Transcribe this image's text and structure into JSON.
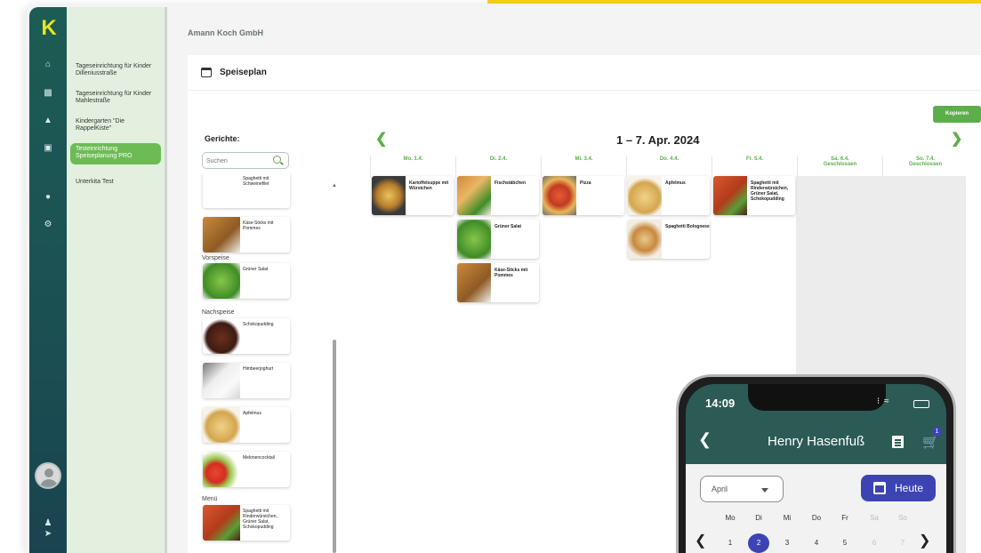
{
  "app": {
    "logo_letter": "K",
    "company": "Amann Koch GmbH",
    "colors": {
      "brand_dark": "#1d5c55",
      "accent_green": "#5cae4a",
      "logo_yellow": "#e6e61d",
      "phone_primary": "#3c44b3"
    }
  },
  "rail": {
    "icons": [
      "home-icon",
      "layers-icon",
      "upload-icon",
      "calendar-icon",
      "users-icon",
      "gear-icon",
      "person-icon",
      "logout-icon"
    ]
  },
  "sidebar": {
    "items": [
      {
        "label": "Tageseinrichtung für Kinder Dilleniusstraße"
      },
      {
        "label": "Tageseinrichtung für Kinder Mahlestraße"
      },
      {
        "label": "Kindergarten \"Die RappelKiste\""
      },
      {
        "label": "Testeinrichtung Speiseplanung PRO",
        "active": true
      },
      {
        "label": "Unterkita Test"
      }
    ]
  },
  "page": {
    "title": "Speiseplan",
    "copy_button": "Kopieren",
    "dishes_label": "Gerichte:",
    "search_placeholder": "Suchen"
  },
  "dish_list": {
    "top_items": [
      "Spaghetti mit Schweinefilet",
      "Käse-Sticks mit Pommes"
    ],
    "categories": [
      {
        "name": "Vorspeise",
        "items": [
          "Grüner Salat"
        ]
      },
      {
        "name": "Nachspeise",
        "items": [
          "Schokopudding",
          "Himbeerjoghurt",
          "Apfelmus",
          "Melonencocktail"
        ]
      },
      {
        "name": "Menü",
        "items": [
          "Spaghetti mit Rinderwürstchen, Grüner Salat, Schokopudding"
        ]
      }
    ]
  },
  "week": {
    "title": "1 – 7. Apr. 2024",
    "days": [
      {
        "label": "Mo. 1.4."
      },
      {
        "label": "Di. 2.4."
      },
      {
        "label": "Mi. 3.4."
      },
      {
        "label": "Do. 4.4."
      },
      {
        "label": "Fr. 5.4."
      },
      {
        "label": "Sa. 6.4.",
        "closed": "Geschlossen"
      },
      {
        "label": "So. 7.4.",
        "closed": "Geschlossen"
      }
    ],
    "meals": [
      [
        "Kartoffelsuppe mit Würstchen"
      ],
      [
        "Fischstäbchen",
        "Grüner Salat",
        "Käse-Sticks mit Pommes"
      ],
      [
        "Pizza"
      ],
      [
        "Apfelmus",
        "Spaghetti Bolognese"
      ],
      [
        "Spaghetti mit Rinderwürstchen, Grüner Salat, Schokopudding"
      ]
    ]
  },
  "phone": {
    "time": "14:09",
    "user_name": "Henry Hasenfuß",
    "cart_count": "1",
    "month": "April",
    "today_button": "Heute",
    "weekdays": [
      "Mo",
      "Di",
      "Mi",
      "Do",
      "Fr",
      "Sa",
      "So"
    ],
    "dates": [
      "1",
      "2",
      "3",
      "4",
      "5",
      "6",
      "7"
    ],
    "selected_date": "2"
  }
}
